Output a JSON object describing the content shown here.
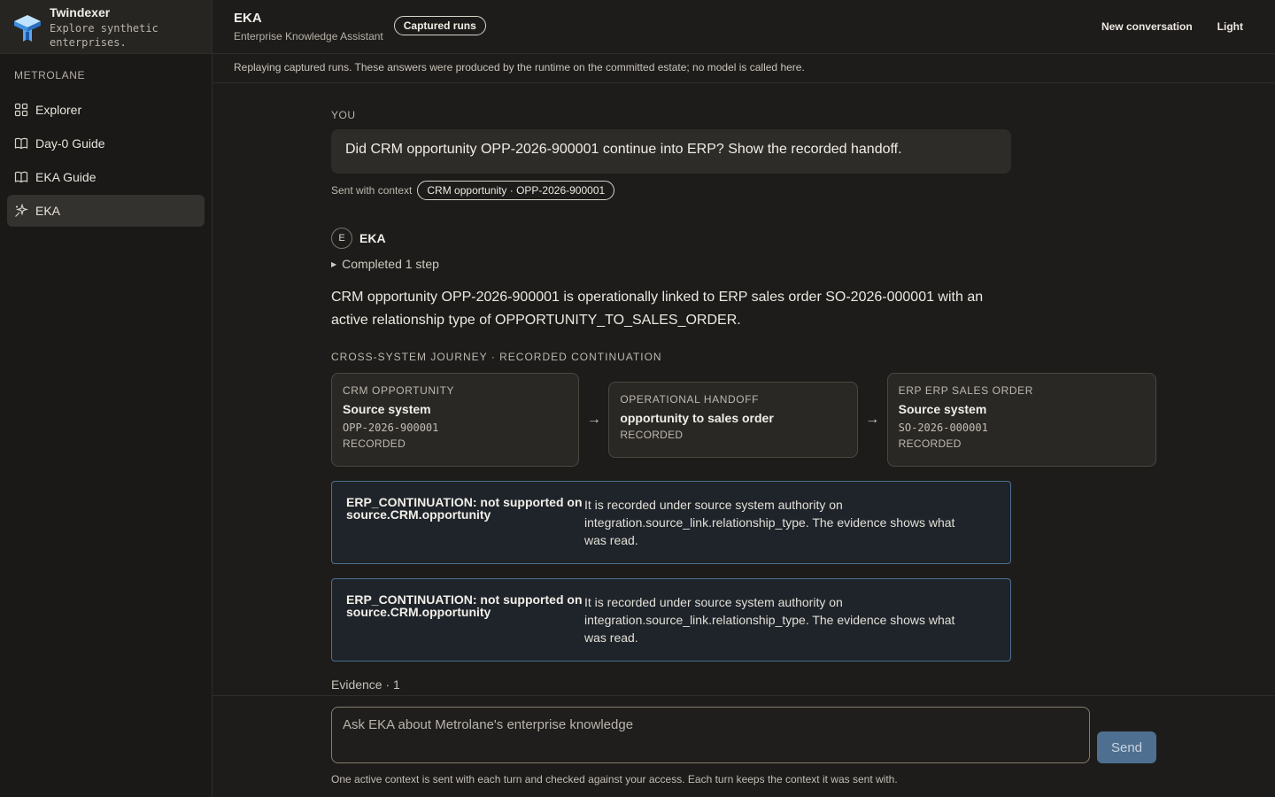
{
  "brand": {
    "name": "Twindexer",
    "tagline": "Explore synthetic\nenterprises."
  },
  "sidebar": {
    "section": "METROLANE",
    "items": [
      {
        "label": "Explorer",
        "icon": "grid-icon",
        "active": false
      },
      {
        "label": "Day-0 Guide",
        "icon": "book-icon",
        "active": false
      },
      {
        "label": "EKA Guide",
        "icon": "book-icon",
        "active": false
      },
      {
        "label": "EKA",
        "icon": "sparkle-icon",
        "active": true
      }
    ]
  },
  "header": {
    "title": "EKA",
    "subtitle": "Enterprise Knowledge Assistant",
    "badge": "Captured runs",
    "new_conversation": "New conversation",
    "theme_toggle": "Light"
  },
  "notice": "Replaying captured runs. These answers were produced by the runtime on the committed estate; no model is called here.",
  "thread": {
    "you_label": "YOU",
    "user_message": "Did CRM opportunity OPP-2026-900001 continue into ERP? Show the recorded handoff.",
    "context_prefix": "Sent with context",
    "context_chip": "CRM opportunity · OPP-2026-900001",
    "assistant_avatar": "E",
    "assistant_name": "EKA",
    "steps": "Completed 1 step",
    "answer": "CRM opportunity OPP-2026-900001 is operationally linked to ERP sales order SO-2026-000001 with an active relationship type of OPPORTUNITY_TO_SALES_ORDER.",
    "journey_label": "CROSS-SYSTEM JOURNEY · RECORDED CONTINUATION",
    "journey": [
      {
        "kicker": "CRM OPPORTUNITY",
        "title": "Source system",
        "id": "OPP-2026-900001",
        "status": "RECORDED"
      },
      {
        "kicker": "OPERATIONAL HANDOFF",
        "title": "opportunity to sales order",
        "status": "RECORDED"
      },
      {
        "kicker": "ERP ERP SALES ORDER",
        "title": "Source system",
        "id": "SO-2026-000001",
        "status": "RECORDED"
      }
    ],
    "callouts": [
      {
        "title": "ERP_CONTINUATION: not supported on source.CRM.opportunity",
        "body": "It is recorded under source system authority on integration.source_link.relationship_type. The evidence shows what was read."
      },
      {
        "title": "ERP_CONTINUATION: not supported on source.CRM.opportunity",
        "body": "It is recorded under source system authority on integration.source_link.relationship_type. The evidence shows what was read."
      }
    ],
    "evidence": "Evidence · 1"
  },
  "composer": {
    "placeholder": "Ask EKA about Metrolane's enterprise knowledge",
    "send_label": "Send",
    "footnote": "One active context is sent with each turn and checked against your access. Each turn keeps the context it was sent with."
  },
  "colors": {
    "accent": "#4e6f8f",
    "callout_border": "#4c6f8f",
    "background": "#1d1c1a"
  }
}
